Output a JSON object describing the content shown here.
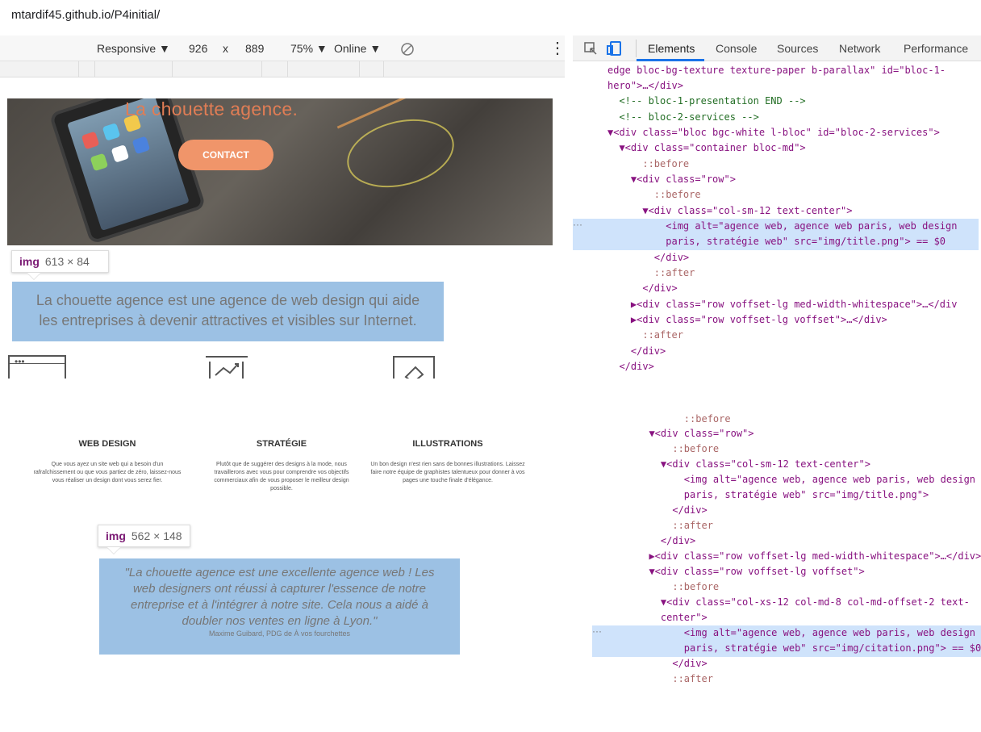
{
  "browser": {
    "url": "mtardif45.github.io/P4initial/"
  },
  "device_toolbar": {
    "mode": "Responsive ▼",
    "width": "926",
    "times": "x",
    "height": "889",
    "zoom": "75% ▼",
    "network": "Online ▼",
    "more": "⋮"
  },
  "page": {
    "hero_title": "La chouette agence.",
    "contact": "CONTACT",
    "tooltip_img": "img",
    "tooltip_size_1": "613 × 84",
    "intro_line_1": "La chouette agence est une agence de web design qui aide",
    "intro_line_2": "les entreprises à devenir attractives et visibles sur Internet."
  },
  "devtools": {
    "tabs": [
      "Elements",
      "Console",
      "Sources",
      "Network",
      "Performance"
    ],
    "top_lines": [
      "edge bloc-bg-texture texture-paper b-parallax\" id=\"bloc-1-",
      "hero\">…</div>",
      "  <!-- bloc-1-presentation END -->",
      "  <!-- bloc-2-services -->",
      "▼<div class=\"bloc bgc-white l-bloc\" id=\"bloc-2-services\">",
      "  ▼<div class=\"container bloc-md\">",
      "      ::before",
      "    ▼<div class=\"row\">",
      "        ::before",
      "      ▼<div class=\"col-sm-12 text-center\">",
      "          <img alt=\"agence web, agence web paris, web design",
      "          paris, stratégie web\" src=\"img/title.png\"> == $0",
      "        </div>",
      "        ::after",
      "      </div>",
      "    ▶<div class=\"row voffset-lg med-width-whitespace\">…</div",
      "    ▶<div class=\"row voffset-lg voffset\">…</div>",
      "      ::after",
      "    </div>",
      "  </div>"
    ],
    "bottom_lines": [
      "        ::before",
      "  ▼<div class=\"row\">",
      "      ::before",
      "    ▼<div class=\"col-sm-12 text-center\">",
      "        <img alt=\"agence web, agence web paris, web design",
      "        paris, stratégie web\" src=\"img/title.png\">",
      "      </div>",
      "      ::after",
      "    </div>",
      "  ▶<div class=\"row voffset-lg med-width-whitespace\">…</div>",
      "  ▼<div class=\"row voffset-lg voffset\">",
      "      ::before",
      "    ▼<div class=\"col-xs-12 col-md-8 col-md-offset-2 text-",
      "    center\">",
      "        <img alt=\"agence web, agence web paris, web design",
      "        paris, stratégie web\" src=\"img/citation.png\"> == $0",
      "      </div>",
      "      ::after"
    ],
    "ellipsis": "···"
  },
  "services": [
    {
      "title": "WEB DESIGN",
      "text": "Que vous ayez un site web qui a besoin d'un rafraîchissement ou que vous partiez de zéro, laissez-nous vous réaliser un design dont vous serez fier."
    },
    {
      "title": "STRATÉGIE",
      "text": "Plutôt que de suggérer des designs à la mode, nous travaillerons avec vous pour comprendre vos objectifs commerciaux afin de vous proposer le meilleur design possible."
    },
    {
      "title": "ILLUSTRATIONS",
      "text": "Un bon design n'est rien sans de bonnes illustrations. Laissez faire notre équipe de graphistes talentueux pour donner à vos pages une touche finale d'élégance."
    }
  ],
  "quote": {
    "tooltip_img": "img",
    "tooltip_size_2": "562 × 148",
    "line_1": "\"La chouette agence est une excellente agence web ! Les",
    "line_2": "web designers ont réussi à capturer l'essence de notre",
    "line_3": "entreprise et à l'intégrer à notre site. Cela nous a aidé à",
    "line_4": "doubler nos ventes en ligne à Lyon.\"",
    "author": "Maxime Guibard, PDG de À vos fourchettes"
  }
}
